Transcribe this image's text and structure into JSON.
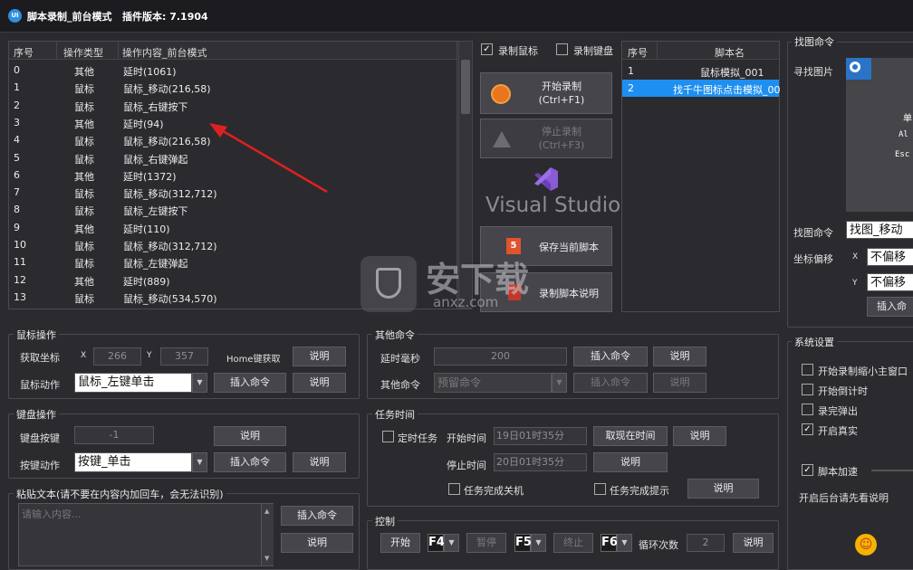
{
  "title": {
    "app": "脚本录制_前台模式",
    "version": "插件版本: 7.1904"
  },
  "actions_table": {
    "headers": [
      "序号",
      "操作类型",
      "操作内容_前台模式"
    ],
    "rows": [
      [
        "0",
        "其他",
        "延时(1061)"
      ],
      [
        "1",
        "鼠标",
        "鼠标_移动(216,58)"
      ],
      [
        "2",
        "鼠标",
        "鼠标_右键按下"
      ],
      [
        "3",
        "其他",
        "延时(94)"
      ],
      [
        "4",
        "鼠标",
        "鼠标_移动(216,58)"
      ],
      [
        "5",
        "鼠标",
        "鼠标_右键弹起"
      ],
      [
        "6",
        "其他",
        "延时(1372)"
      ],
      [
        "7",
        "鼠标",
        "鼠标_移动(312,712)"
      ],
      [
        "8",
        "鼠标",
        "鼠标_左键按下"
      ],
      [
        "9",
        "其他",
        "延时(110)"
      ],
      [
        "10",
        "鼠标",
        "鼠标_移动(312,712)"
      ],
      [
        "11",
        "鼠标",
        "鼠标_左键弹起"
      ],
      [
        "12",
        "其他",
        "延时(889)"
      ],
      [
        "13",
        "鼠标",
        "鼠标_移动(534,570)"
      ]
    ]
  },
  "record": {
    "record_mouse": "录制鼠标",
    "record_keyboard": "录制键盘",
    "start_line1": "开始录制",
    "start_line2": "(Ctrl+F1)",
    "stop_line1": "停止录制",
    "stop_line2": "(Ctrl+F3)",
    "vs_text": "Visual Studio",
    "save": "保存当前脚本",
    "script_desc": "录制脚本说明"
  },
  "scripts_table": {
    "headers": [
      "序号",
      "脚本名"
    ],
    "rows": [
      [
        "1",
        "鼠标模拟_001"
      ],
      [
        "2",
        "找千牛图标点击模拟_00"
      ]
    ]
  },
  "find_image": {
    "group": "找图命令",
    "find_label": "寻找图片",
    "preview_lines": [
      "单",
      "Al",
      "Esc"
    ],
    "cmd_label": "找图命令",
    "cmd_value": "找图_移动",
    "offset_label": "坐标偏移",
    "x_label": "X",
    "x_value": "不偏移",
    "y_label": "Y",
    "y_value": "不偏移",
    "insert": "插入命"
  },
  "mouse_ops": {
    "group": "鼠标操作",
    "get_coord": "获取坐标",
    "x_label": "X",
    "x_value": "266",
    "y_label": "Y",
    "y_value": "357",
    "home_key": "Home键获取",
    "desc": "说明",
    "action_label": "鼠标动作",
    "action_value": "鼠标_左键单击",
    "insert": "插入命令",
    "desc2": "说明"
  },
  "keyboard_ops": {
    "group": "键盘操作",
    "key_label": "键盘按键",
    "key_value": "-1",
    "desc": "说明",
    "action_label": "按键动作",
    "action_value": "按键_单击",
    "insert": "插入命令",
    "desc2": "说明"
  },
  "paste": {
    "group": "粘贴文本(请不要在内容内加回车，会无法识别)",
    "placeholder": "请输入内容...",
    "insert": "插入命令",
    "desc": "说明"
  },
  "other_cmds": {
    "group": "其他命令",
    "delay_label": "延时毫秒",
    "delay_value": "200",
    "insert": "插入命令",
    "desc": "说明",
    "other_label": "其他命令",
    "other_value": "预留命令",
    "insert2": "插入命令",
    "desc2": "说明"
  },
  "task_time": {
    "group": "任务时间",
    "timed_task": "定时任务",
    "start_label": "开始时间",
    "start_value": "19日01时35分",
    "take_now": "取现在时间",
    "desc": "说明",
    "stop_label": "停止时间",
    "stop_value": "20日01时35分",
    "desc2": "说明",
    "shutdown": "任务完成关机",
    "notify": "任务完成提示",
    "desc3": "说明"
  },
  "control": {
    "group": "控制",
    "start": "开始",
    "f4": "F4",
    "pause": "暂停",
    "f5": "F5",
    "stop": "终止",
    "f6": "F6",
    "loop_label": "循环次数",
    "loop_value": "2",
    "desc": "说明"
  },
  "system": {
    "group": "系统设置",
    "opt1": "开始录制缩小主窗口",
    "opt2": "开始倒计时",
    "opt3": "录完弹出",
    "opt4": "开启真实",
    "opt5": "脚本加速",
    "hint": "开启后台请先看说明"
  },
  "watermark": {
    "brand": "安下载",
    "domain": "anxz.com"
  },
  "colors": {
    "selected_row": "#1e8ff0",
    "arrow": "#e02020",
    "accent": "#2f8fe0"
  }
}
